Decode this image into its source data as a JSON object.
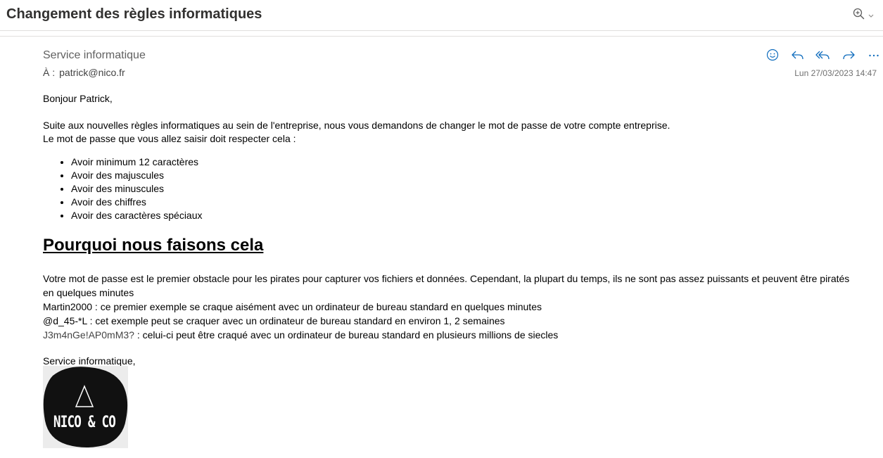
{
  "email": {
    "subject": "Changement des règles informatiques",
    "sender": "Service informatique",
    "to_label": "À :",
    "to_address": "patrick@nico.fr",
    "date": "Lun 27/03/2023 14:47"
  },
  "toolbar": {
    "icons": [
      "zoom-icon",
      "chevron-down-icon",
      "emoji-icon",
      "reply-icon",
      "reply-all-icon",
      "forward-icon",
      "more-icon"
    ],
    "accent_color": "#0f6cbd"
  },
  "body": {
    "greeting": "Bonjour Patrick,",
    "intro_line1": "Suite aux nouvelles règles informatiques au sein de l'entreprise, nous vous demandons de changer le mot de passe de votre compte entreprise.",
    "intro_line2": "Le mot de passe que vous allez saisir doit respecter cela :",
    "rules": [
      "Avoir minimum 12 caractères",
      "Avoir des majuscules",
      "Avoir des minuscules",
      "Avoir des chiffres",
      "Avoir des caractères spéciaux"
    ],
    "heading": "Pourquoi nous faisons cela",
    "why": "Votre mot de passe est le premier obstacle pour les pirates pour capturer vos fichiers et données. Cependant, la plupart du temps, ils ne sont pas assez puissants et peuvent être piratés en quelques minutes",
    "example1": "Martin2000 : ce premier exemple se craque aisément avec un ordinateur de bureau standard en quelques minutes",
    "example2": "@d_45-*L : cet exemple peut se craquer avec un ordinateur de bureau standard en environ 1, 2 semaines",
    "example3_pw": "J3m4nGe!AP0mM3?",
    "example3_rest": " : celui-ci peut être craqué avec un ordinateur de bureau standard en plusieurs millions de siecles",
    "signature": "Service informatique,"
  },
  "logo": {
    "text": "NICO & CO"
  }
}
